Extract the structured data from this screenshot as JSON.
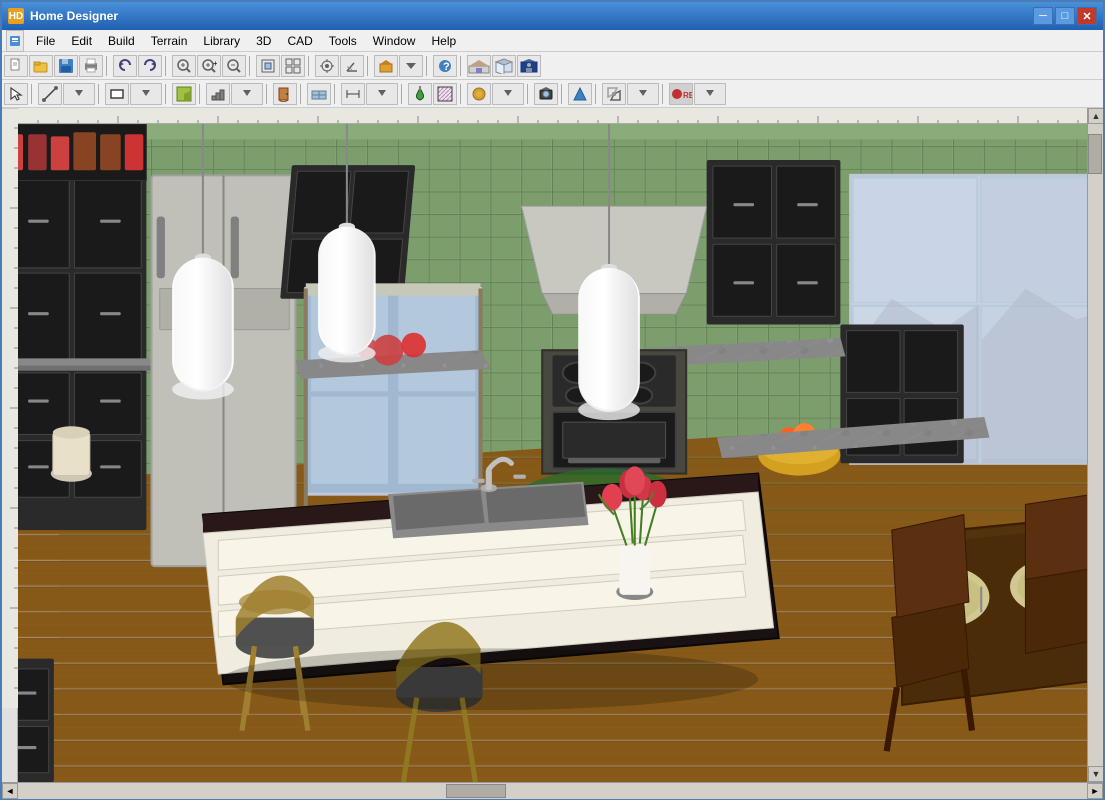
{
  "window": {
    "title": "Home Designer",
    "icon": "HD"
  },
  "title_controls": {
    "minimize": "─",
    "maximize": "□",
    "close": "✕"
  },
  "menu": {
    "items": [
      {
        "id": "file",
        "label": "File"
      },
      {
        "id": "edit",
        "label": "Edit"
      },
      {
        "id": "build",
        "label": "Build"
      },
      {
        "id": "terrain",
        "label": "Terrain"
      },
      {
        "id": "library",
        "label": "Library"
      },
      {
        "id": "3d",
        "label": "3D"
      },
      {
        "id": "cad",
        "label": "CAD"
      },
      {
        "id": "tools",
        "label": "Tools"
      },
      {
        "id": "window",
        "label": "Window"
      },
      {
        "id": "help",
        "label": "Help"
      }
    ]
  },
  "toolbar1": {
    "buttons": [
      {
        "id": "new",
        "icon": "📄",
        "label": "New"
      },
      {
        "id": "open",
        "icon": "📂",
        "label": "Open"
      },
      {
        "id": "save",
        "icon": "💾",
        "label": "Save"
      },
      {
        "id": "print",
        "icon": "🖨",
        "label": "Print"
      },
      {
        "id": "undo",
        "icon": "↩",
        "label": "Undo"
      },
      {
        "id": "redo",
        "icon": "↪",
        "label": "Redo"
      },
      {
        "id": "zoom-out-rect",
        "icon": "🔍",
        "label": "Zoom Out Rectangle"
      },
      {
        "id": "zoom-in",
        "icon": "⊕",
        "label": "Zoom In"
      },
      {
        "id": "zoom-out",
        "icon": "⊖",
        "label": "Zoom Out"
      },
      {
        "id": "fill-window",
        "icon": "⤢",
        "label": "Fill Window"
      },
      {
        "id": "zoom-tools",
        "icon": "⬚",
        "label": "Zoom Tools"
      },
      {
        "id": "toolbar-extra1",
        "icon": "◈",
        "label": "Extra 1"
      },
      {
        "id": "toolbar-extra2",
        "icon": "▲",
        "label": "Extra 2"
      },
      {
        "id": "toolbar-extra3",
        "icon": "△",
        "label": "Extra 3"
      },
      {
        "id": "toolbar-extra4",
        "icon": "⋈",
        "label": "Extra 4"
      },
      {
        "id": "toolbar-extra5",
        "icon": "≫",
        "label": "Extra 5"
      },
      {
        "id": "toolbar-extra6",
        "icon": "❓",
        "label": "Help"
      },
      {
        "id": "house-icon",
        "icon": "⌂",
        "label": "House View"
      },
      {
        "id": "house-front",
        "icon": "🏠",
        "label": "House Front"
      },
      {
        "id": "house-3d",
        "icon": "⬟",
        "label": "3D House"
      }
    ]
  },
  "toolbar2": {
    "buttons": [
      {
        "id": "select",
        "icon": "↖",
        "label": "Select"
      },
      {
        "id": "polyline",
        "icon": "⌐",
        "label": "Polyline"
      },
      {
        "id": "wall",
        "icon": "⊟",
        "label": "Wall"
      },
      {
        "id": "cabinet",
        "icon": "⬛",
        "label": "Cabinet"
      },
      {
        "id": "stairs",
        "icon": "⊞",
        "label": "Stairs"
      },
      {
        "id": "door",
        "icon": "▭",
        "label": "Door"
      },
      {
        "id": "window-tool",
        "icon": "⬚",
        "label": "Window"
      },
      {
        "id": "dimension",
        "icon": "←→",
        "label": "Dimension"
      },
      {
        "id": "paint",
        "icon": "🖌",
        "label": "Paint"
      },
      {
        "id": "material",
        "icon": "⬡",
        "label": "Material"
      },
      {
        "id": "camera",
        "icon": "📷",
        "label": "Camera"
      },
      {
        "id": "arrow-up",
        "icon": "↑",
        "label": "Move Up"
      },
      {
        "id": "transform",
        "icon": "⬡",
        "label": "Transform"
      },
      {
        "id": "record",
        "icon": "⏺",
        "label": "Record"
      }
    ]
  },
  "scene": {
    "description": "3D kitchen interior with island, dark cabinets, green tile backsplash",
    "alt_text": "Home Designer 3D kitchen view"
  },
  "scrollbar": {
    "up": "▲",
    "down": "▼",
    "left": "◄",
    "right": "►"
  }
}
